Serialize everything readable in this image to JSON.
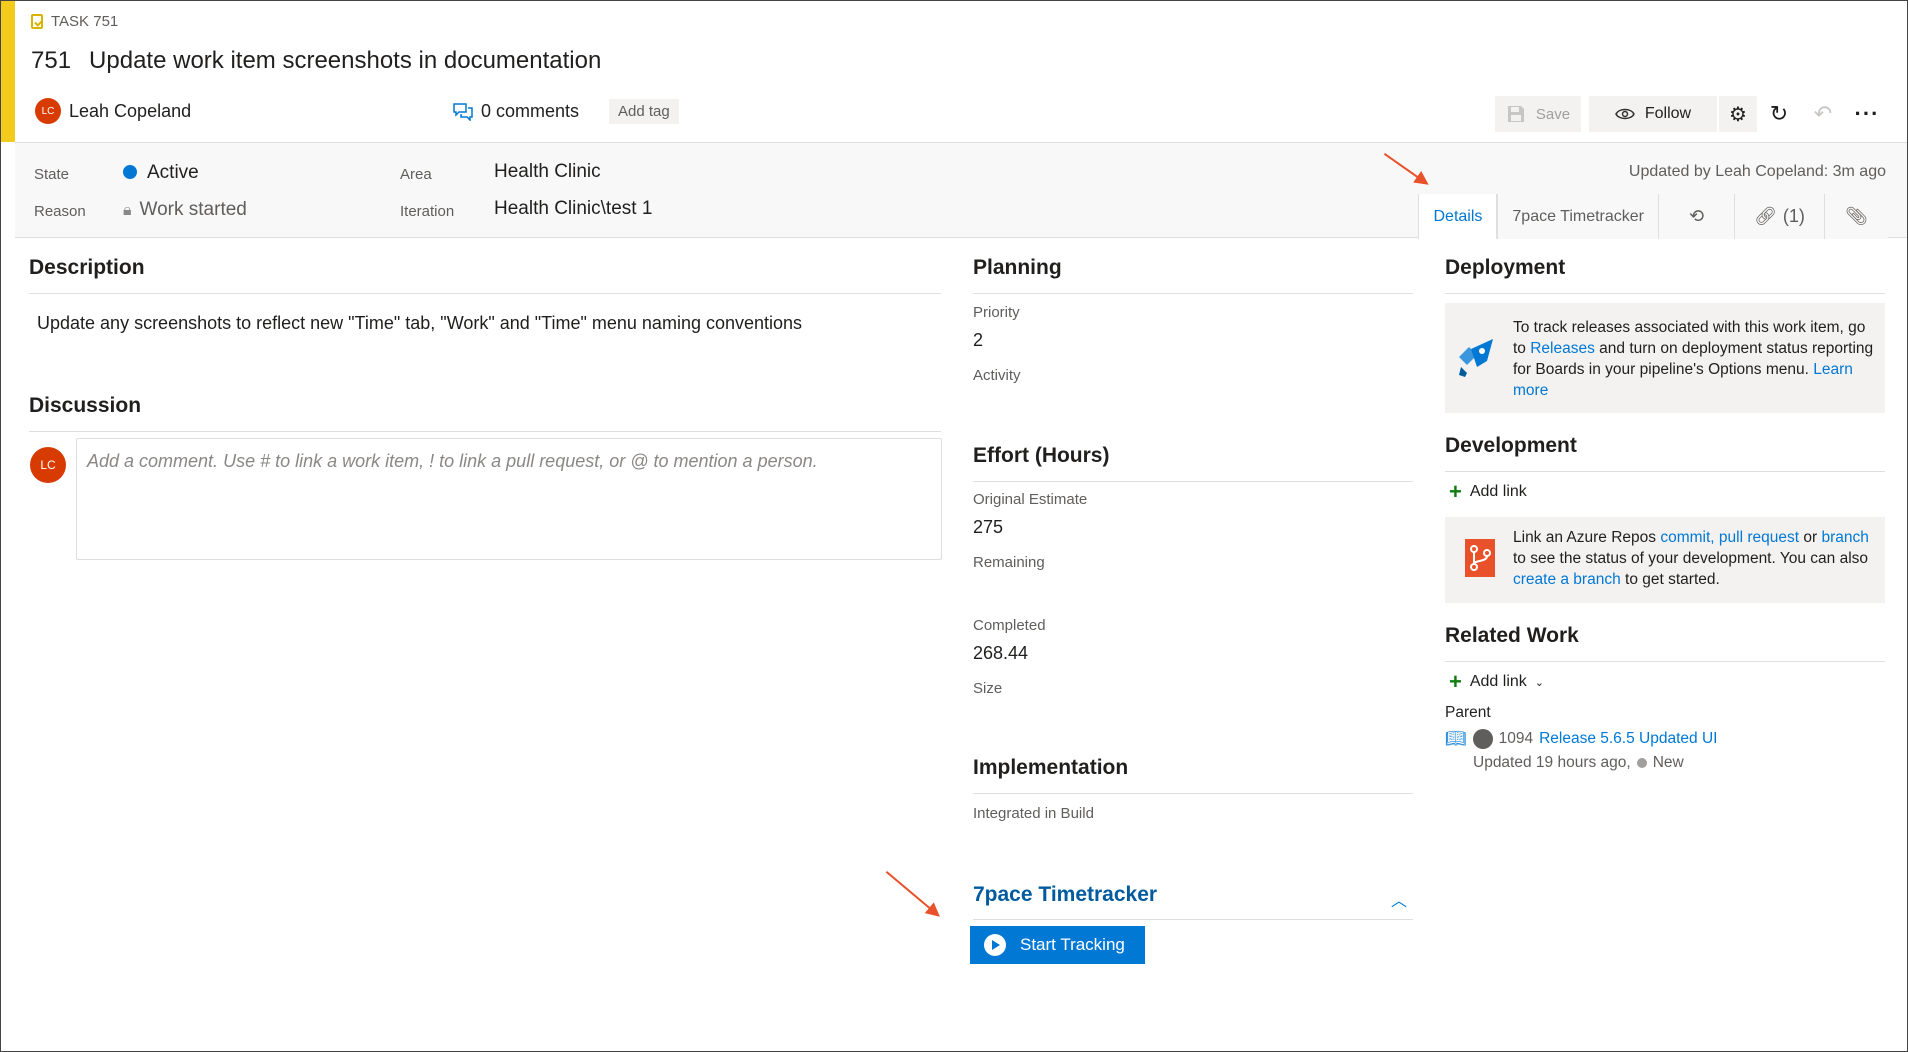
{
  "header": {
    "type_label": "TASK 751",
    "id": "751",
    "title": "Update work item screenshots in documentation",
    "assignee_initials": "LC",
    "assignee": "Leah Copeland",
    "comments": "0 comments",
    "add_tag": "Add tag"
  },
  "toolbar": {
    "save": "Save",
    "follow": "Follow"
  },
  "fields": {
    "state_label": "State",
    "state_value": "Active",
    "reason_label": "Reason",
    "reason_value": "Work started",
    "area_label": "Area",
    "area_value": "Health Clinic",
    "iteration_label": "Iteration",
    "iteration_value": "Health Clinic\\test 1",
    "updated": "Updated by Leah Copeland: 3m ago"
  },
  "tabs": {
    "details": "Details",
    "timetracker": "7pace Timetracker",
    "links": "(1)"
  },
  "description": {
    "title": "Description",
    "text": "Update any screenshots to reflect new \"Time\" tab, \"Work\" and \"Time\" menu naming conventions"
  },
  "discussion": {
    "title": "Discussion",
    "avatar": "LC",
    "placeholder": "Add a comment. Use # to link a work item, ! to link a pull request, or @ to mention a person."
  },
  "planning": {
    "title": "Planning",
    "priority_label": "Priority",
    "priority_value": "2",
    "activity_label": "Activity"
  },
  "effort": {
    "title": "Effort (Hours)",
    "original_label": "Original Estimate",
    "original_value": "275",
    "remaining_label": "Remaining",
    "completed_label": "Completed",
    "completed_value": "268.44",
    "size_label": "Size"
  },
  "implementation": {
    "title": "Implementation",
    "build_label": "Integrated in Build"
  },
  "timetracker": {
    "title": "7pace Timetracker",
    "start": "Start Tracking"
  },
  "deployment": {
    "title": "Deployment",
    "t1": "To track releases associated with this work item, go to ",
    "releases": "Releases",
    "t2": " and turn on deployment status reporting for Boards in your pipeline's Options menu. ",
    "learn_more": "Learn more"
  },
  "development": {
    "title": "Development",
    "add_link": "Add link",
    "t1": "Link an Azure Repos ",
    "commit": "commit,",
    "pull_request": "pull request",
    "t2": " or ",
    "branch": "branch",
    "t3": " to see the status of your development. You can also ",
    "create_branch": "create a branch",
    "t4": " to get started."
  },
  "related": {
    "title": "Related Work",
    "add_link": "Add link",
    "parent_label": "Parent",
    "parent_id": "1094",
    "parent_title": "Release 5.6.5 Updated UI",
    "parent_meta": "Updated 19 hours ago,",
    "parent_state": "New"
  },
  "colors": {
    "accent": "#f2cb1d",
    "primary": "#0078d4",
    "avatar": "#d83b01",
    "annotation_arrow": "#e8512a"
  }
}
